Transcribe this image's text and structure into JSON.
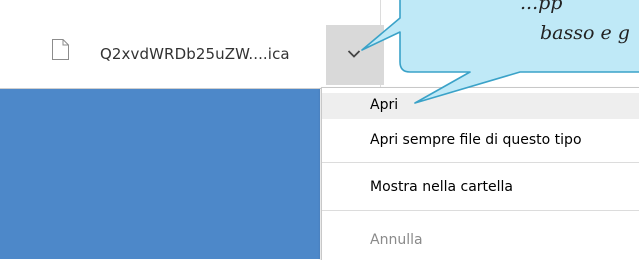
{
  "download": {
    "file_name": "Q2xvdWRDb25uZW....ica"
  },
  "menu": {
    "items": [
      {
        "label": "Apri",
        "state": "highlighted"
      },
      {
        "label": "Apri sempre file di questo tipo",
        "state": "normal"
      },
      {
        "label": "Mostra nella cartella",
        "state": "normal"
      },
      {
        "label": "Annulla",
        "state": "disabled"
      }
    ]
  },
  "callout": {
    "line1": "...pp",
    "line2": "basso e g"
  },
  "colors": {
    "page_blue": "#4d88c9",
    "callout_fill": "#bfe9f7",
    "callout_stroke": "#3aa2c8",
    "dropdown_bg": "#d9d9d9"
  },
  "icons": {
    "file": "file-icon",
    "dropdown": "chevron-down-icon"
  }
}
